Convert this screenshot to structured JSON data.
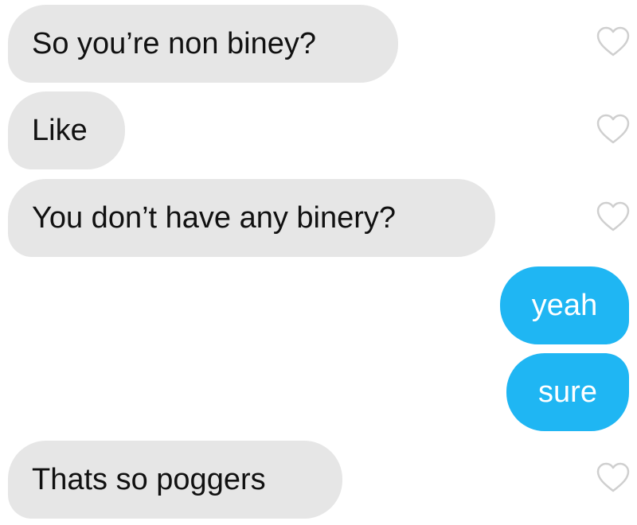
{
  "messages": [
    {
      "side": "received",
      "text": "So you’re non biney?"
    },
    {
      "side": "received",
      "text": "Like"
    },
    {
      "side": "received",
      "text": "You don’t have any binery?"
    },
    {
      "side": "sent",
      "text": "yeah"
    },
    {
      "side": "sent",
      "text": "sure"
    },
    {
      "side": "received",
      "text": "Thats so poggers"
    }
  ],
  "colors": {
    "received_bubble": "#e6e6e6",
    "sent_bubble": "#1fb6f3",
    "heart_outline": "#cfcfcf"
  },
  "icons": {
    "like": "heart-outline-icon"
  }
}
